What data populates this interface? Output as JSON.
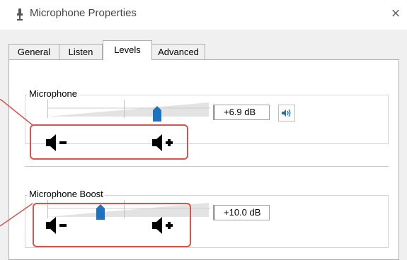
{
  "window": {
    "title": "Microphone Properties",
    "close_glyph": "×",
    "icon": "microphone-icon"
  },
  "tabs": [
    {
      "label": "General",
      "active": false
    },
    {
      "label": "Listen",
      "active": false
    },
    {
      "label": "Levels",
      "active": true
    },
    {
      "label": "Advanced",
      "active": false
    }
  ],
  "levels": {
    "microphone": {
      "label": "Microphone",
      "value_text": "+6.9 dB",
      "slider_fraction": 0.68,
      "speaker_icon": "speaker-volume-icon"
    },
    "boost": {
      "label": "Microphone Boost",
      "value_text": "+10.0 dB",
      "slider_fraction": 0.33
    }
  },
  "annotations": {
    "color": "#d9534f",
    "icons": [
      "volume-down-icon",
      "volume-up-icon"
    ]
  },
  "colors": {
    "accent": "#1e73be",
    "annotation": "#d9534f"
  }
}
